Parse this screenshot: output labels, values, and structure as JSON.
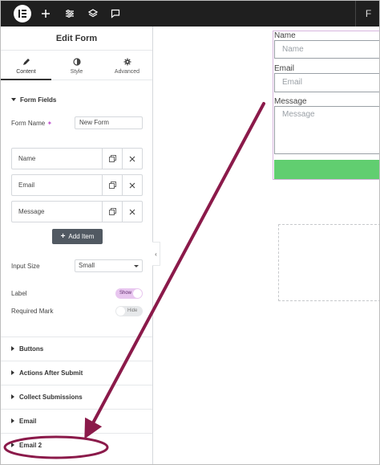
{
  "topbar": {
    "logo_icon": "elementor-logo-icon",
    "icons": [
      "plus-icon",
      "sliders-icon",
      "layers-icon",
      "comment-icon"
    ],
    "right_text": "F"
  },
  "panel": {
    "title": "Edit Form",
    "tabs": [
      {
        "label": "Content",
        "icon": "pencil-icon",
        "active": true
      },
      {
        "label": "Style",
        "icon": "half-circle-icon",
        "active": false
      },
      {
        "label": "Advanced",
        "icon": "gear-icon",
        "active": false
      }
    ],
    "form_fields": {
      "heading": "Form Fields",
      "form_name_label": "Form Name",
      "form_name_value": "New Form",
      "items": [
        {
          "label": "Name"
        },
        {
          "label": "Email"
        },
        {
          "label": "Message"
        }
      ],
      "add_item_label": "Add Item",
      "input_size_label": "Input Size",
      "input_size_value": "Small",
      "label_label": "Label",
      "label_toggle": "Show",
      "required_mark_label": "Required Mark",
      "required_mark_toggle": "Hide"
    },
    "sections": [
      {
        "label": "Buttons"
      },
      {
        "label": "Actions After Submit"
      },
      {
        "label": "Collect Submissions"
      },
      {
        "label": "Email"
      },
      {
        "label": "Email 2"
      }
    ]
  },
  "preview": {
    "name_label": "Name",
    "name_placeholder": "Name",
    "email_label": "Email",
    "email_placeholder": "Email",
    "message_label": "Message",
    "message_placeholder": "Message",
    "submit_color": "#61ce70"
  },
  "annotation": {
    "arrow_color": "#8b1a4a"
  }
}
